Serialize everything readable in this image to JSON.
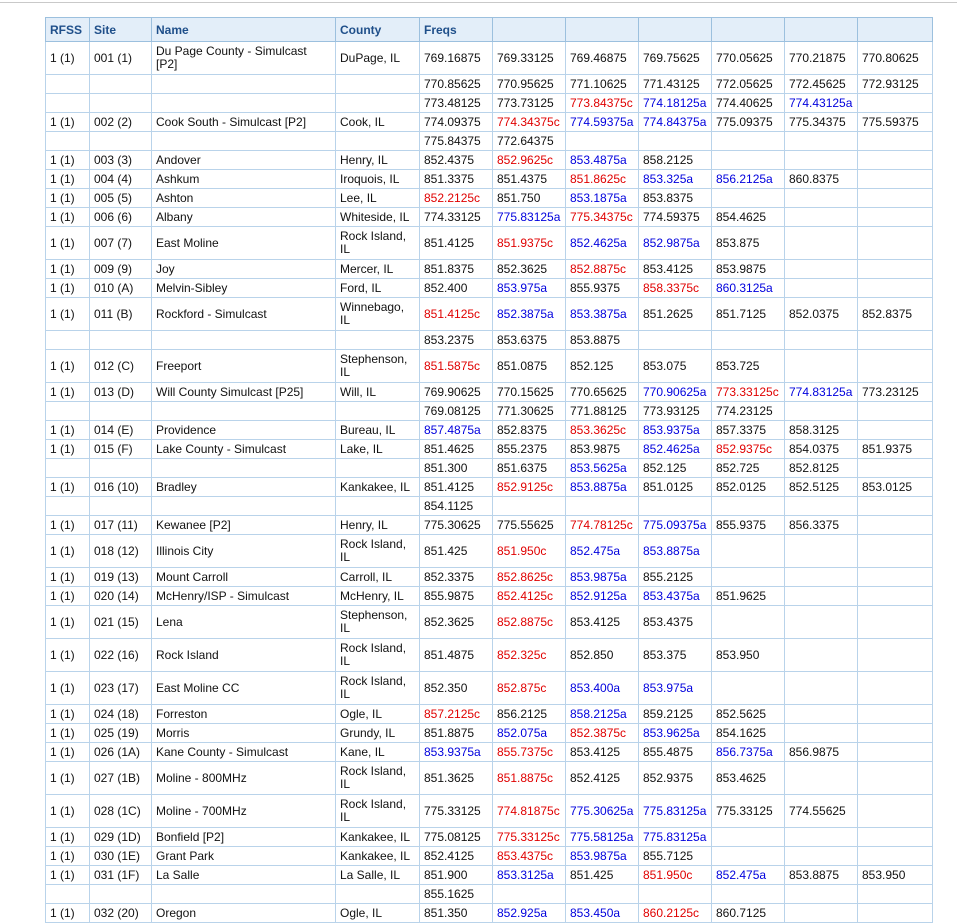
{
  "headers": [
    "RFSS",
    "Site",
    "Name",
    "County",
    "Freqs",
    "",
    "",
    "",
    "",
    "",
    ""
  ],
  "rows": [
    {
      "rfss": "1 (1)",
      "site": "001 (1)",
      "name": "Du Page County - Simulcast [P2]",
      "county": "DuPage, IL",
      "tall": true,
      "freqs": [
        "769.16875",
        "769.33125",
        "769.46875",
        "769.75625",
        "770.05625",
        "770.21875",
        "770.80625"
      ]
    },
    {
      "rfss": "",
      "site": "",
      "name": "",
      "county": "",
      "freqs": [
        "770.85625",
        "770.95625",
        "771.10625",
        "771.43125",
        "772.05625",
        "772.45625",
        "772.93125"
      ]
    },
    {
      "rfss": "",
      "site": "",
      "name": "",
      "county": "",
      "freqs": [
        "773.48125",
        "773.73125",
        "773.84375c",
        "774.18125a",
        "774.40625",
        "774.43125a",
        ""
      ]
    },
    {
      "rfss": "1 (1)",
      "site": "002 (2)",
      "name": "Cook South - Simulcast [P2]",
      "county": "Cook, IL",
      "freqs": [
        "774.09375",
        "774.34375c",
        "774.59375a",
        "774.84375a",
        "775.09375",
        "775.34375",
        "775.59375"
      ]
    },
    {
      "rfss": "",
      "site": "",
      "name": "",
      "county": "",
      "freqs": [
        "775.84375",
        "772.64375",
        "",
        "",
        "",
        "",
        ""
      ]
    },
    {
      "rfss": "1 (1)",
      "site": "003 (3)",
      "name": "Andover",
      "county": "Henry, IL",
      "freqs": [
        "852.4375",
        "852.9625c",
        "853.4875a",
        "858.2125",
        "",
        "",
        ""
      ]
    },
    {
      "rfss": "1 (1)",
      "site": "004 (4)",
      "name": "Ashkum",
      "county": "Iroquois, IL",
      "freqs": [
        "851.3375",
        "851.4375",
        "851.8625c",
        "853.325a",
        "856.2125a",
        "860.8375",
        ""
      ]
    },
    {
      "rfss": "1 (1)",
      "site": "005 (5)",
      "name": "Ashton",
      "county": "Lee, IL",
      "freqs": [
        "852.2125c",
        "851.750",
        "853.1875a",
        "853.8375",
        "",
        "",
        ""
      ]
    },
    {
      "rfss": "1 (1)",
      "site": "006 (6)",
      "name": "Albany",
      "county": "Whiteside, IL",
      "freqs": [
        "774.33125",
        "775.83125a",
        "775.34375c",
        "774.59375",
        "854.4625",
        "",
        ""
      ]
    },
    {
      "rfss": "1 (1)",
      "site": "007 (7)",
      "name": "East Moline",
      "county": "Rock Island, IL",
      "tall": true,
      "freqs": [
        "851.4125",
        "851.9375c",
        "852.4625a",
        "852.9875a",
        "853.875",
        "",
        ""
      ]
    },
    {
      "rfss": "1 (1)",
      "site": "009 (9)",
      "name": "Joy",
      "county": "Mercer, IL",
      "freqs": [
        "851.8375",
        "852.3625",
        "852.8875c",
        "853.4125",
        "853.9875",
        "",
        ""
      ]
    },
    {
      "rfss": "1 (1)",
      "site": "010 (A)",
      "name": "Melvin-Sibley",
      "county": "Ford, IL",
      "freqs": [
        "852.400",
        "853.975a",
        "855.9375",
        "858.3375c",
        "860.3125a",
        "",
        ""
      ]
    },
    {
      "rfss": "1 (1)",
      "site": "011 (B)",
      "name": "Rockford - Simulcast",
      "county": "Winnebago, IL",
      "tall": true,
      "freqs": [
        "851.4125c",
        "852.3875a",
        "853.3875a",
        "851.2625",
        "851.7125",
        "852.0375",
        "852.8375"
      ]
    },
    {
      "rfss": "",
      "site": "",
      "name": "",
      "county": "",
      "freqs": [
        "853.2375",
        "853.6375",
        "853.8875",
        "",
        "",
        "",
        ""
      ]
    },
    {
      "rfss": "1 (1)",
      "site": "012 (C)",
      "name": "Freeport",
      "county": "Stephenson, IL",
      "tall": true,
      "freqs": [
        "851.5875c",
        "851.0875",
        "852.125",
        "853.075",
        "853.725",
        "",
        ""
      ]
    },
    {
      "rfss": "1 (1)",
      "site": "013 (D)",
      "name": "Will County Simulcast [P25]",
      "county": "Will, IL",
      "freqs": [
        "769.90625",
        "770.15625",
        "770.65625",
        "770.90625a",
        "773.33125c",
        "774.83125a",
        "773.23125"
      ]
    },
    {
      "rfss": "",
      "site": "",
      "name": "",
      "county": "",
      "freqs": [
        "769.08125",
        "771.30625",
        "771.88125",
        "773.93125",
        "774.23125",
        "",
        ""
      ]
    },
    {
      "rfss": "1 (1)",
      "site": "014 (E)",
      "name": "Providence",
      "county": "Bureau, IL",
      "freqs": [
        "857.4875a",
        "852.8375",
        "853.3625c",
        "853.9375a",
        "857.3375",
        "858.3125",
        ""
      ]
    },
    {
      "rfss": "1 (1)",
      "site": "015 (F)",
      "name": "Lake County - Simulcast",
      "county": "Lake, IL",
      "freqs": [
        "851.4625",
        "855.2375",
        "853.9875",
        "852.4625a",
        "852.9375c",
        "854.0375",
        "851.9375"
      ]
    },
    {
      "rfss": "",
      "site": "",
      "name": "",
      "county": "",
      "freqs": [
        "851.300",
        "851.6375",
        "853.5625a",
        "852.125",
        "852.725",
        "852.8125",
        ""
      ]
    },
    {
      "rfss": "1 (1)",
      "site": "016 (10)",
      "name": "Bradley",
      "county": "Kankakee, IL",
      "freqs": [
        "851.4125",
        "852.9125c",
        "853.8875a",
        "851.0125",
        "852.0125",
        "852.5125",
        "853.0125"
      ]
    },
    {
      "rfss": "",
      "site": "",
      "name": "",
      "county": "",
      "freqs": [
        "854.1125",
        "",
        "",
        "",
        "",
        "",
        ""
      ]
    },
    {
      "rfss": "1 (1)",
      "site": "017 (11)",
      "name": "Kewanee [P2]",
      "county": "Henry, IL",
      "freqs": [
        "775.30625",
        "775.55625",
        "774.78125c",
        "775.09375a",
        "855.9375",
        "856.3375",
        ""
      ]
    },
    {
      "rfss": "1 (1)",
      "site": "018 (12)",
      "name": "Illinois City",
      "county": "Rock Island, IL",
      "tall": true,
      "freqs": [
        "851.425",
        "851.950c",
        "852.475a",
        "853.8875a",
        "",
        "",
        ""
      ]
    },
    {
      "rfss": "1 (1)",
      "site": "019 (13)",
      "name": "Mount Carroll",
      "county": "Carroll, IL",
      "freqs": [
        "852.3375",
        "852.8625c",
        "853.9875a",
        "855.2125",
        "",
        "",
        ""
      ]
    },
    {
      "rfss": "1 (1)",
      "site": "020 (14)",
      "name": "McHenry/ISP - Simulcast",
      "county": "McHenry, IL",
      "freqs": [
        "855.9875",
        "852.4125c",
        "852.9125a",
        "853.4375a",
        "851.9625",
        "",
        ""
      ]
    },
    {
      "rfss": "1 (1)",
      "site": "021 (15)",
      "name": "Lena",
      "county": "Stephenson, IL",
      "tall": true,
      "freqs": [
        "852.3625",
        "852.8875c",
        "853.4125",
        "853.4375",
        "",
        "",
        ""
      ]
    },
    {
      "rfss": "1 (1)",
      "site": "022 (16)",
      "name": "Rock Island",
      "county": "Rock Island, IL",
      "tall": true,
      "freqs": [
        "851.4875",
        "852.325c",
        "852.850",
        "853.375",
        "853.950",
        "",
        ""
      ]
    },
    {
      "rfss": "1 (1)",
      "site": "023 (17)",
      "name": "East Moline CC",
      "county": "Rock Island, IL",
      "tall": true,
      "freqs": [
        "852.350",
        "852.875c",
        "853.400a",
        "853.975a",
        "",
        "",
        ""
      ]
    },
    {
      "rfss": "1 (1)",
      "site": "024 (18)",
      "name": "Forreston",
      "county": "Ogle, IL",
      "freqs": [
        "857.2125c",
        "856.2125",
        "858.2125a",
        "859.2125",
        "852.5625",
        "",
        ""
      ]
    },
    {
      "rfss": "1 (1)",
      "site": "025 (19)",
      "name": "Morris",
      "county": "Grundy, IL",
      "freqs": [
        "851.8875",
        "852.075a",
        "852.3875c",
        "853.9625a",
        "854.1625",
        "",
        ""
      ]
    },
    {
      "rfss": "1 (1)",
      "site": "026 (1A)",
      "name": "Kane County - Simulcast",
      "county": "Kane, IL",
      "freqs": [
        "853.9375a",
        "855.7375c",
        "853.4125",
        "855.4875",
        "856.7375a",
        "856.9875",
        ""
      ]
    },
    {
      "rfss": "1 (1)",
      "site": "027 (1B)",
      "name": "Moline - 800MHz",
      "county": "Rock Island, IL",
      "tall": true,
      "freqs": [
        "851.3625",
        "851.8875c",
        "852.4125",
        "852.9375",
        "853.4625",
        "",
        ""
      ]
    },
    {
      "rfss": "1 (1)",
      "site": "028 (1C)",
      "name": "Moline - 700MHz",
      "county": "Rock Island, IL",
      "tall": true,
      "freqs": [
        "775.33125",
        "774.81875c",
        "775.30625a",
        "775.83125a",
        "775.33125",
        "774.55625",
        ""
      ]
    },
    {
      "rfss": "1 (1)",
      "site": "029 (1D)",
      "name": "Bonfield [P2]",
      "county": "Kankakee, IL",
      "freqs": [
        "775.08125",
        "775.33125c",
        "775.58125a",
        "775.83125a",
        "",
        "",
        ""
      ]
    },
    {
      "rfss": "1 (1)",
      "site": "030 (1E)",
      "name": "Grant Park",
      "county": "Kankakee, IL",
      "freqs": [
        "852.4125",
        "853.4375c",
        "853.9875a",
        "855.7125",
        "",
        "",
        ""
      ]
    },
    {
      "rfss": "1 (1)",
      "site": "031 (1F)",
      "name": "La Salle",
      "county": "La Salle, IL",
      "freqs": [
        "851.900",
        "853.3125a",
        "851.425",
        "851.950c",
        "852.475a",
        "853.8875",
        "853.950"
      ]
    },
    {
      "rfss": "",
      "site": "",
      "name": "",
      "county": "",
      "freqs": [
        "855.1625",
        "",
        "",
        "",
        "",
        "",
        ""
      ]
    },
    {
      "rfss": "1 (1)",
      "site": "032 (20)",
      "name": "Oregon",
      "county": "Ogle, IL",
      "freqs": [
        "851.350",
        "852.925a",
        "853.450a",
        "860.2125c",
        "860.7125",
        "",
        ""
      ]
    }
  ],
  "colors": {
    "control": "#e00000",
    "alternate": "#0000dd",
    "header_bg": "#e3eef9",
    "header_text": "#1f4f8a",
    "border": "#b9d3ea"
  }
}
